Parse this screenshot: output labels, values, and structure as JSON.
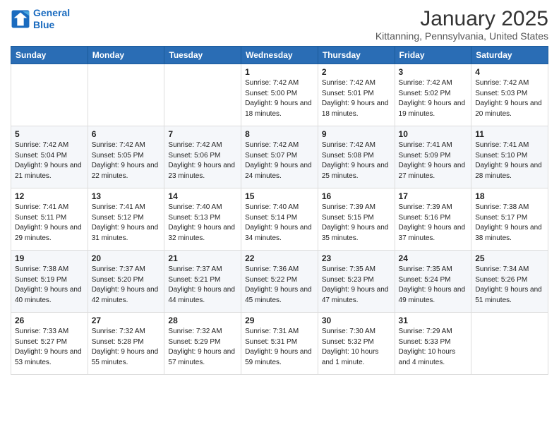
{
  "logo": {
    "line1": "General",
    "line2": "Blue"
  },
  "header": {
    "month": "January 2025",
    "location": "Kittanning, Pennsylvania, United States"
  },
  "weekdays": [
    "Sunday",
    "Monday",
    "Tuesday",
    "Wednesday",
    "Thursday",
    "Friday",
    "Saturday"
  ],
  "weeks": [
    [
      null,
      null,
      null,
      {
        "day": 1,
        "sunrise": "7:42 AM",
        "sunset": "5:00 PM",
        "daylight": "9 hours and 18 minutes."
      },
      {
        "day": 2,
        "sunrise": "7:42 AM",
        "sunset": "5:01 PM",
        "daylight": "9 hours and 18 minutes."
      },
      {
        "day": 3,
        "sunrise": "7:42 AM",
        "sunset": "5:02 PM",
        "daylight": "9 hours and 19 minutes."
      },
      {
        "day": 4,
        "sunrise": "7:42 AM",
        "sunset": "5:03 PM",
        "daylight": "9 hours and 20 minutes."
      }
    ],
    [
      {
        "day": 5,
        "sunrise": "7:42 AM",
        "sunset": "5:04 PM",
        "daylight": "9 hours and 21 minutes."
      },
      {
        "day": 6,
        "sunrise": "7:42 AM",
        "sunset": "5:05 PM",
        "daylight": "9 hours and 22 minutes."
      },
      {
        "day": 7,
        "sunrise": "7:42 AM",
        "sunset": "5:06 PM",
        "daylight": "9 hours and 23 minutes."
      },
      {
        "day": 8,
        "sunrise": "7:42 AM",
        "sunset": "5:07 PM",
        "daylight": "9 hours and 24 minutes."
      },
      {
        "day": 9,
        "sunrise": "7:42 AM",
        "sunset": "5:08 PM",
        "daylight": "9 hours and 25 minutes."
      },
      {
        "day": 10,
        "sunrise": "7:41 AM",
        "sunset": "5:09 PM",
        "daylight": "9 hours and 27 minutes."
      },
      {
        "day": 11,
        "sunrise": "7:41 AM",
        "sunset": "5:10 PM",
        "daylight": "9 hours and 28 minutes."
      }
    ],
    [
      {
        "day": 12,
        "sunrise": "7:41 AM",
        "sunset": "5:11 PM",
        "daylight": "9 hours and 29 minutes."
      },
      {
        "day": 13,
        "sunrise": "7:41 AM",
        "sunset": "5:12 PM",
        "daylight": "9 hours and 31 minutes."
      },
      {
        "day": 14,
        "sunrise": "7:40 AM",
        "sunset": "5:13 PM",
        "daylight": "9 hours and 32 minutes."
      },
      {
        "day": 15,
        "sunrise": "7:40 AM",
        "sunset": "5:14 PM",
        "daylight": "9 hours and 34 minutes."
      },
      {
        "day": 16,
        "sunrise": "7:39 AM",
        "sunset": "5:15 PM",
        "daylight": "9 hours and 35 minutes."
      },
      {
        "day": 17,
        "sunrise": "7:39 AM",
        "sunset": "5:16 PM",
        "daylight": "9 hours and 37 minutes."
      },
      {
        "day": 18,
        "sunrise": "7:38 AM",
        "sunset": "5:17 PM",
        "daylight": "9 hours and 38 minutes."
      }
    ],
    [
      {
        "day": 19,
        "sunrise": "7:38 AM",
        "sunset": "5:19 PM",
        "daylight": "9 hours and 40 minutes."
      },
      {
        "day": 20,
        "sunrise": "7:37 AM",
        "sunset": "5:20 PM",
        "daylight": "9 hours and 42 minutes."
      },
      {
        "day": 21,
        "sunrise": "7:37 AM",
        "sunset": "5:21 PM",
        "daylight": "9 hours and 44 minutes."
      },
      {
        "day": 22,
        "sunrise": "7:36 AM",
        "sunset": "5:22 PM",
        "daylight": "9 hours and 45 minutes."
      },
      {
        "day": 23,
        "sunrise": "7:35 AM",
        "sunset": "5:23 PM",
        "daylight": "9 hours and 47 minutes."
      },
      {
        "day": 24,
        "sunrise": "7:35 AM",
        "sunset": "5:24 PM",
        "daylight": "9 hours and 49 minutes."
      },
      {
        "day": 25,
        "sunrise": "7:34 AM",
        "sunset": "5:26 PM",
        "daylight": "9 hours and 51 minutes."
      }
    ],
    [
      {
        "day": 26,
        "sunrise": "7:33 AM",
        "sunset": "5:27 PM",
        "daylight": "9 hours and 53 minutes."
      },
      {
        "day": 27,
        "sunrise": "7:32 AM",
        "sunset": "5:28 PM",
        "daylight": "9 hours and 55 minutes."
      },
      {
        "day": 28,
        "sunrise": "7:32 AM",
        "sunset": "5:29 PM",
        "daylight": "9 hours and 57 minutes."
      },
      {
        "day": 29,
        "sunrise": "7:31 AM",
        "sunset": "5:31 PM",
        "daylight": "9 hours and 59 minutes."
      },
      {
        "day": 30,
        "sunrise": "7:30 AM",
        "sunset": "5:32 PM",
        "daylight": "10 hours and 1 minute."
      },
      {
        "day": 31,
        "sunrise": "7:29 AM",
        "sunset": "5:33 PM",
        "daylight": "10 hours and 4 minutes."
      },
      null
    ]
  ]
}
